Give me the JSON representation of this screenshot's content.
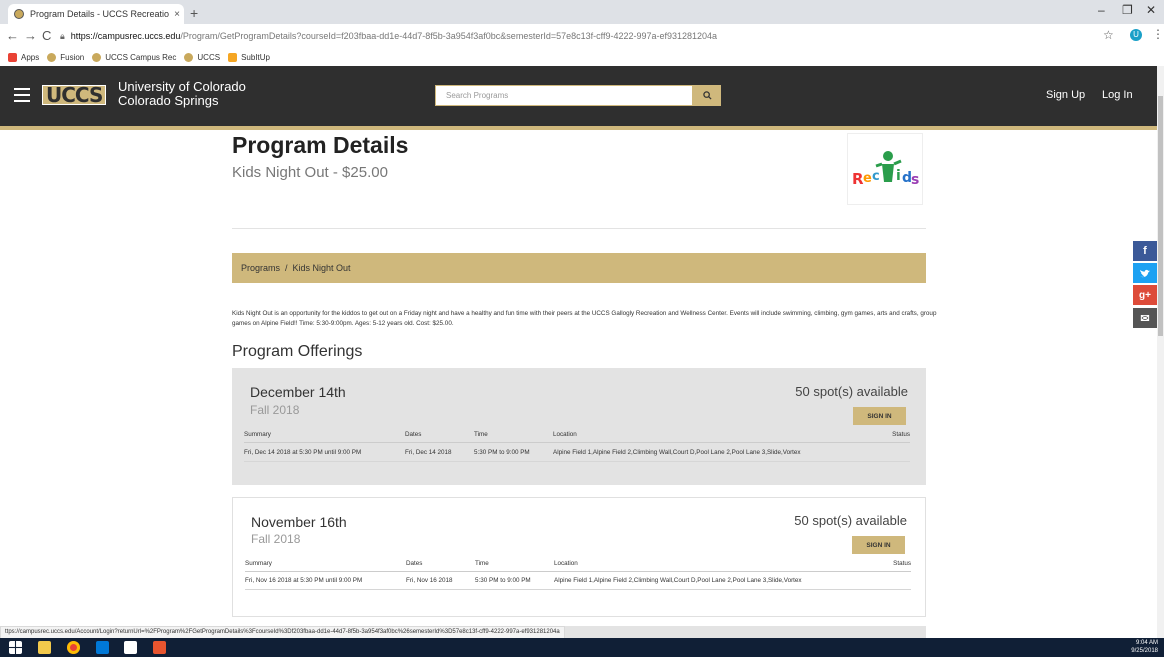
{
  "browser": {
    "tab_title": "Program Details - UCCS Recreatio",
    "tab_close": "×",
    "new_tab": "+",
    "url_host": "https://campusrec.uccs.edu",
    "url_path": "/Program/GetProgramDetails?courseId=f203fbaa-dd1e-44d7-8f5b-3a954f3af0bc&semesterId=57e8c13f-cff9-4222-997a-ef931281204a",
    "profile_initial": "U",
    "bookmarks": [
      {
        "label": "Apps",
        "color": "#e94235"
      },
      {
        "label": "Fusion",
        "color": "#c9a95c"
      },
      {
        "label": "UCCS Campus Rec",
        "color": "#c9a95c"
      },
      {
        "label": "UCCS",
        "color": "#c9a95c"
      },
      {
        "label": "SubItUp",
        "color": "#f5a623"
      }
    ],
    "status_url": "ttps://campusrec.uccs.edu/Account/Login?returnUrl=%2FProgram%2FGetProgramDetails%3FcourseId%3Df203fbaa-dd1e-44d7-8f5b-3a954f3af0bc%26semesterId%3D57e8c13f-cff9-4222-997a-ef931281204a"
  },
  "header": {
    "logo_text": "UCCS",
    "university_line1": "University of Colorado",
    "university_line2": "Colorado Springs",
    "search_placeholder": "Search Programs",
    "signup": "Sign Up",
    "login": "Log In"
  },
  "social": [
    {
      "name": "facebook-icon",
      "glyph": "f",
      "color": "#3b5998"
    },
    {
      "name": "twitter-icon",
      "glyph": "t",
      "color": "#1da1f2"
    },
    {
      "name": "google-plus-icon",
      "glyph": "g+",
      "color": "#dd4b39"
    },
    {
      "name": "email-icon",
      "glyph": "✉",
      "color": "#555555"
    }
  ],
  "page": {
    "title": "Program Details",
    "subtitle": "Kids Night Out - $25.00",
    "logo_text": "RecKids",
    "breadcrumb": {
      "programs": "Programs",
      "separator": "/",
      "current": "Kids Night Out"
    },
    "description": "Kids Night Out is an opportunity for the kiddos to get out on a Friday night and have a healthy and fun time with their peers at the UCCS Gallogly Recreation and Wellness Center. Events will include swimming, climbing, gym games, arts and crafts, group games on Alpine Field!! Time: 5:30-9:00pm. Ages: 5-12 years old. Cost: $25.00.",
    "offerings_heading": "Program Offerings"
  },
  "columns": {
    "summary": "Summary",
    "dates": "Dates",
    "time": "Time",
    "location": "Location",
    "status": "Status"
  },
  "offerings": [
    {
      "date_label": "December 14th",
      "semester": "Fall 2018",
      "spots": "50 spot(s) available",
      "sign_in": "SIGN IN",
      "summary": "Fri, Dec 14 2018 at 5:30 PM until 9:00 PM",
      "dates": "Fri, Dec 14 2018",
      "time": "5:30 PM to 9:00 PM",
      "location": "Alpine Field 1,Alpine Field 2,Climbing Wall,Court D,Pool Lane 2,Pool Lane 3,Slide,Vortex"
    },
    {
      "date_label": "November 16th",
      "semester": "Fall 2018",
      "spots": "50 spot(s) available",
      "sign_in": "SIGN IN",
      "summary": "Fri, Nov 16 2018 at 5:30 PM until 9:00 PM",
      "dates": "Fri, Nov 16 2018",
      "time": "5:30 PM to 9:00 PM",
      "location": "Alpine Field 1,Alpine Field 2,Climbing Wall,Court D,Pool Lane 2,Pool Lane 3,Slide,Vortex"
    }
  ],
  "taskbar": {
    "time": "9:04 AM",
    "date": "9/25/2018"
  },
  "colors": {
    "gold": "#cfb87c",
    "header_bg": "#2f2f2f",
    "card_bg": "#e3e3e3"
  }
}
